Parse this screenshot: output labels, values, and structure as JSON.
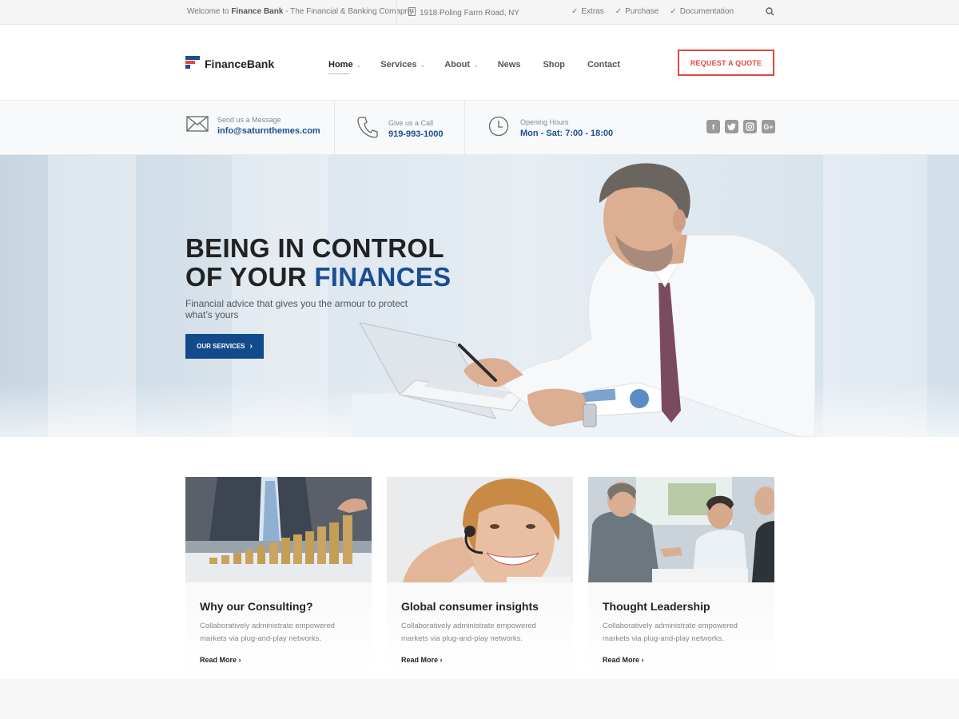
{
  "topbar": {
    "welcome_prefix": "Welcome to ",
    "welcome_brand": "Finance Bank",
    "welcome_suffix": " - The Financial & Banking Comapny",
    "address": "1918 Poling Farm Road, NY",
    "links": [
      "Extras",
      "Purchase",
      "Documentation"
    ]
  },
  "header": {
    "logo": "FinanceBank",
    "nav": [
      {
        "label": "Home",
        "dropdown": true,
        "active": true
      },
      {
        "label": "Services",
        "dropdown": true
      },
      {
        "label": "About",
        "dropdown": true
      },
      {
        "label": "News",
        "dropdown": false
      },
      {
        "label": "Shop",
        "dropdown": false
      },
      {
        "label": "Contact",
        "dropdown": false
      }
    ],
    "quote_button": "REQUEST A QUOTE"
  },
  "info": {
    "message_label": "Send us a Message",
    "message_value": "info@saturnthemes.com",
    "call_label": "Give us a Call",
    "call_value": "919-993-1000",
    "hours_label": "Opening Hours",
    "hours_value": "Mon - Sat: 7:00 - 18:00",
    "social": [
      "facebook-icon",
      "twitter-icon",
      "instagram-icon",
      "google-plus-icon"
    ]
  },
  "hero": {
    "line1": "BEING IN CONTROL",
    "line2_prefix": "OF YOUR ",
    "line2_highlight": "FINANCES",
    "subtitle": "Financial advice that gives you the armour to protect what’s yours",
    "button": "OUR SERVICES"
  },
  "cards": [
    {
      "title": "Why our Consulting?",
      "text": "Collaboratively administrate empowered markets via plug-and-play networks.",
      "more": "Read More"
    },
    {
      "title": "Global consumer insights",
      "text": "Collaboratively administrate empowered markets via plug-and-play networks.",
      "more": "Read More"
    },
    {
      "title": "Thought Leadership",
      "text": "Collaboratively administrate empowered markets via plug-and-play networks.",
      "more": "Read More"
    }
  ],
  "colors": {
    "accent_blue": "#1a4e92",
    "accent_red": "#e2473b"
  }
}
